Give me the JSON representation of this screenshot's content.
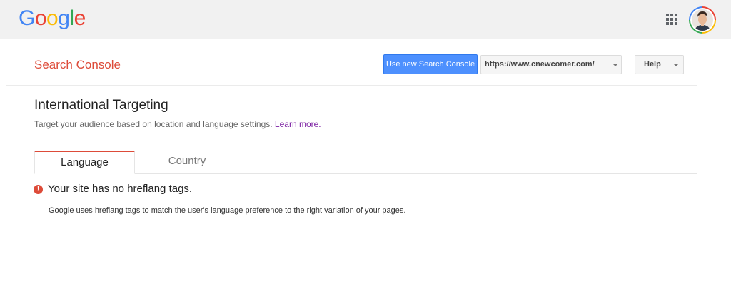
{
  "topbar": {
    "logo_letters": [
      {
        "char": "G",
        "color": "#4285f4"
      },
      {
        "char": "o",
        "color": "#ea4335"
      },
      {
        "char": "o",
        "color": "#fbbc05"
      },
      {
        "char": "g",
        "color": "#4285f4"
      },
      {
        "char": "l",
        "color": "#34a853"
      },
      {
        "char": "e",
        "color": "#ea4335"
      }
    ],
    "apps_icon": "grid-apps-icon",
    "avatar_icon": "user-avatar"
  },
  "header": {
    "product_name": "Search Console",
    "new_console_button": "Use new Search Console",
    "site_selected": "https://www.cnewcomer.com/",
    "help_label": "Help"
  },
  "page": {
    "title": "International Targeting",
    "subtitle": "Target your audience based on location and language settings.",
    "learn_more": "Learn more."
  },
  "tabs": [
    {
      "label": "Language",
      "active": true
    },
    {
      "label": "Country",
      "active": false
    }
  ],
  "alert": {
    "icon_glyph": "!",
    "title": "Your site has no hreflang tags.",
    "description": "Google uses hreflang tags to match the user's language preference to the right variation of your pages."
  },
  "colors": {
    "accent_red": "#dd4b39",
    "button_blue": "#4d90fe",
    "link_purple": "#7b1fa2"
  }
}
